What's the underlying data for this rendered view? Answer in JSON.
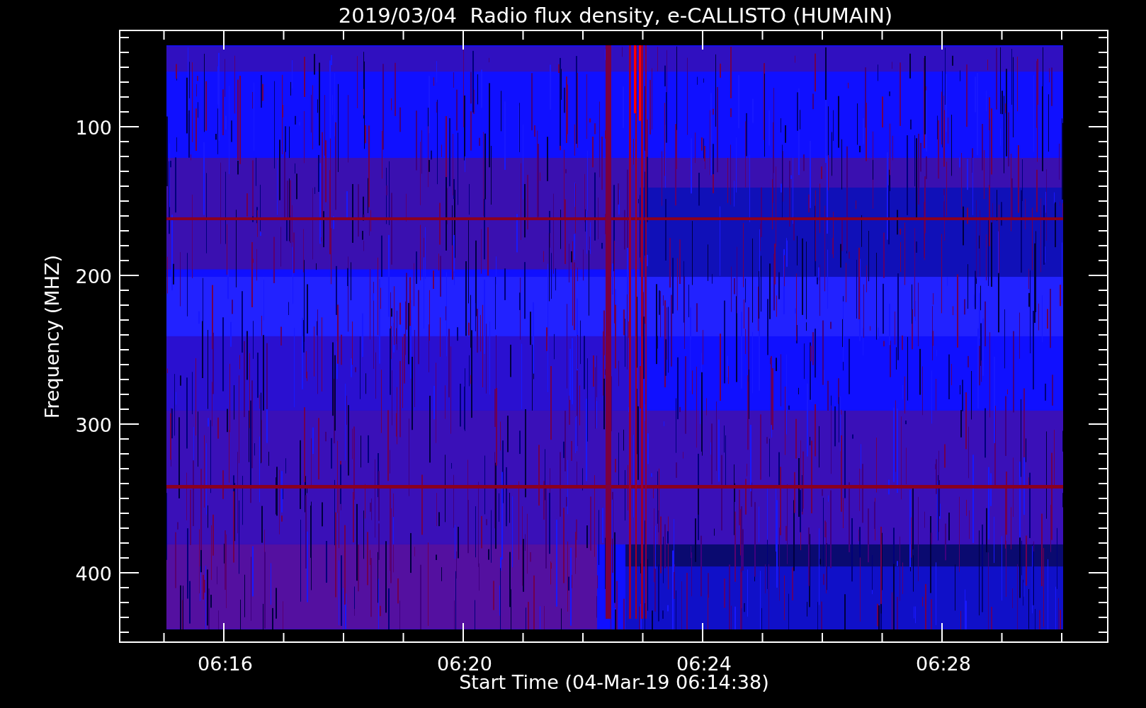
{
  "title": "2019/03/04  Radio flux density, e-CALLISTO (HUMAIN)",
  "y_axis": {
    "label": "Frequency (MHZ)",
    "ticks": [
      "100",
      "200",
      "300",
      "400"
    ]
  },
  "x_axis": {
    "label": "Start Time (04-Mar-19 06:14:38)",
    "ticks": [
      "06:16",
      "06:20",
      "06:24",
      "06:28"
    ]
  }
}
